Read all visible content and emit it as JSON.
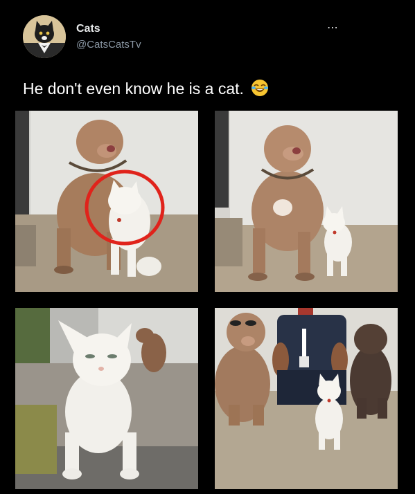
{
  "tweet": {
    "author_name": "Cats",
    "author_handle": "@CatsCatsTv",
    "text": "He don't even know he is a cat.",
    "emoji": "face-with-tears-of-joy-emoji",
    "more_icon": "⋯"
  },
  "photos": [
    {
      "icon": "photo-dog-and-cat-circled"
    },
    {
      "icon": "photo-dog-and-cat-standing"
    },
    {
      "icon": "photo-cat-close-up-dog-behind"
    },
    {
      "icon": "photo-man-with-two-dogs-and-cat"
    }
  ],
  "colors": {
    "background": "#000000",
    "text": "#ffffff",
    "handle": "#8b98a5",
    "circle_highlight": "#e0231b"
  }
}
